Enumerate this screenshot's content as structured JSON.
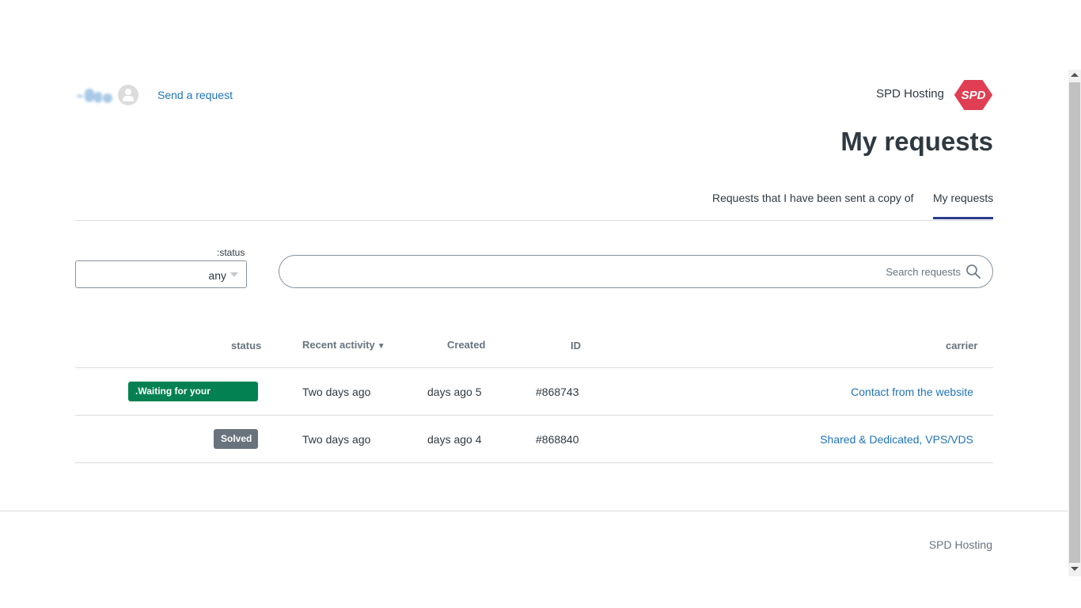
{
  "header": {
    "send_request_label": "Send a request",
    "brand_name": "SPD Hosting",
    "logo_text": "SPD",
    "logo_color": "#e03e52"
  },
  "page_title": "My requests",
  "tabs": [
    {
      "label": "Requests that I have been sent a copy of",
      "active": false
    },
    {
      "label": "My requests",
      "active": true
    }
  ],
  "filter": {
    "status_label": ":status",
    "status_value": "any",
    "search_placeholder": "Search requests",
    "search_icon": "search-icon"
  },
  "table": {
    "headers": {
      "status": "status",
      "recent_activity": "Recent activity",
      "sort_indicator": "▼",
      "created": "Created",
      "id": "ID",
      "carrier": "carrier"
    },
    "rows": [
      {
        "status": ".Waiting for your response",
        "status_color": "#038153",
        "recent_activity": "Two days ago",
        "created": "days ago 5",
        "id": "#868743",
        "carrier": "Contact from the website"
      },
      {
        "status": "Solved",
        "status_color": "#68737d",
        "recent_activity": "Two days ago",
        "created": "days ago 4",
        "id": "#868840",
        "carrier": "Shared & Dedicated, VPS/VDS"
      }
    ]
  },
  "footer": {
    "brand": "SPD Hosting"
  },
  "colors": {
    "accent": "#1f73b7",
    "tab_underline": "#293b8c",
    "text": "#2f3941"
  }
}
